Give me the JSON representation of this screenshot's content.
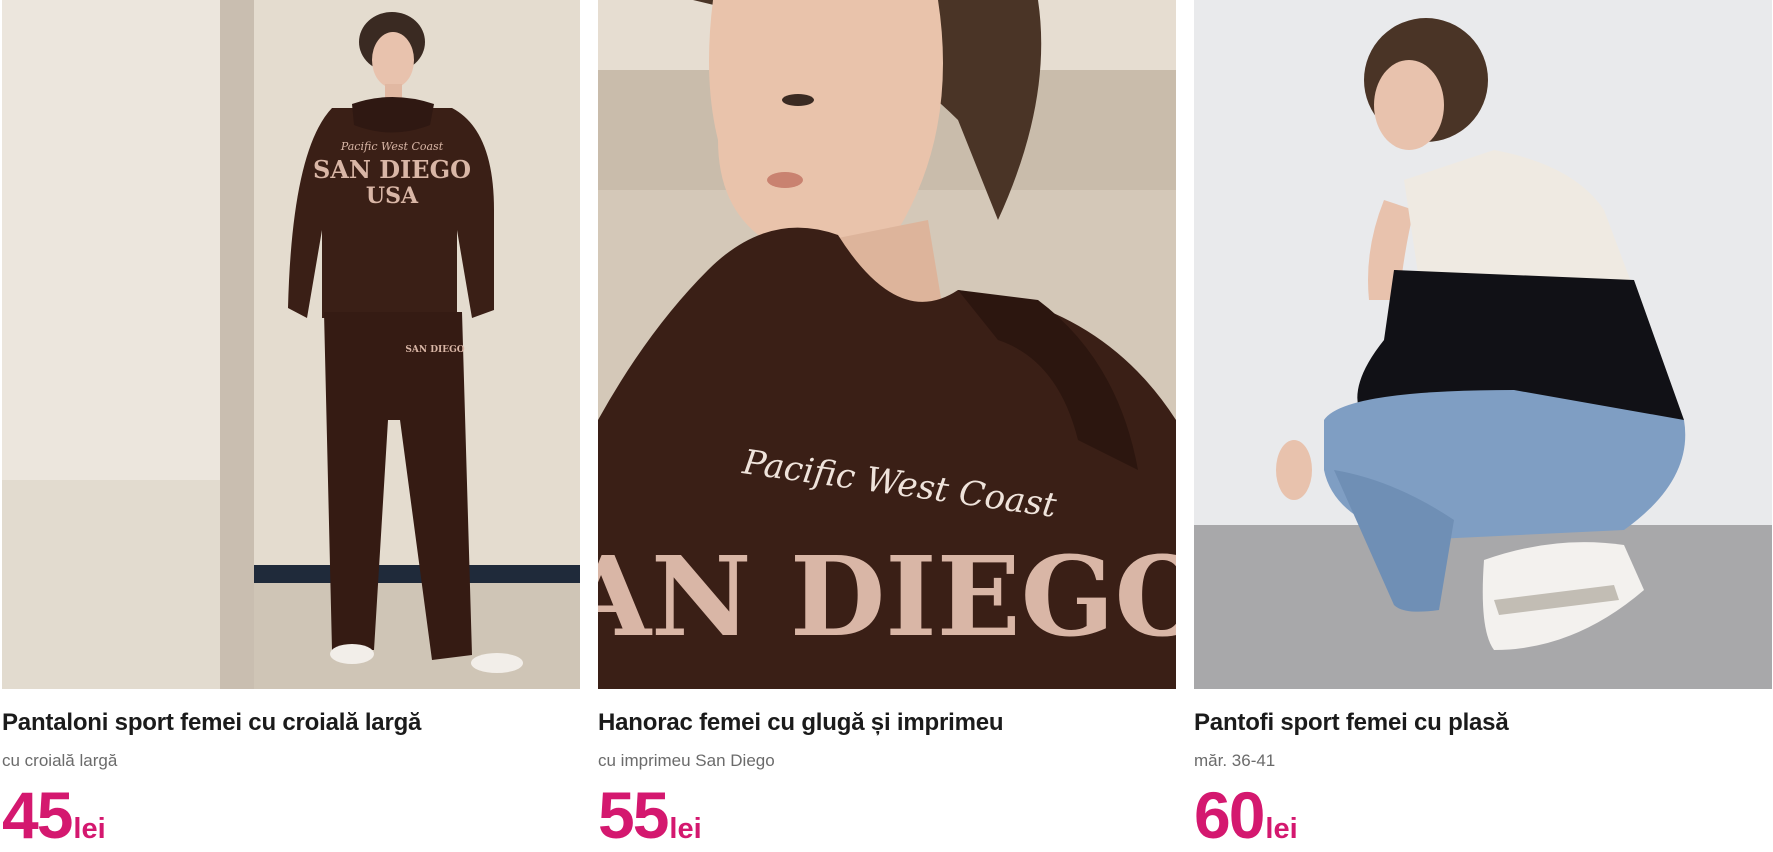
{
  "products": [
    {
      "title": "Pantaloni sport femei cu croială largă",
      "subtitle": "cu croială largă",
      "price": "45",
      "currency": "lei"
    },
    {
      "title": "Hanorac femei cu glugă și imprimeu",
      "subtitle": "cu imprimeu San Diego",
      "price": "55",
      "currency": "lei"
    },
    {
      "title": "Pantofi sport femei cu plasă",
      "subtitle": "măr. 36-41",
      "price": "60",
      "currency": "lei"
    }
  ],
  "prints": {
    "tracksuit_hoodie": [
      "Pacific West Coast",
      "SAN DIEGO",
      "USA"
    ],
    "hoodie_closeup": [
      "Pacific West Coast",
      "AN DIEGO"
    ]
  },
  "colors": {
    "price": "#d4186f",
    "title": "#1b1b1b",
    "subtitle": "#6b6b6b",
    "garment_brown": "#3a1f16",
    "print_beige": "#d9b6a6"
  }
}
